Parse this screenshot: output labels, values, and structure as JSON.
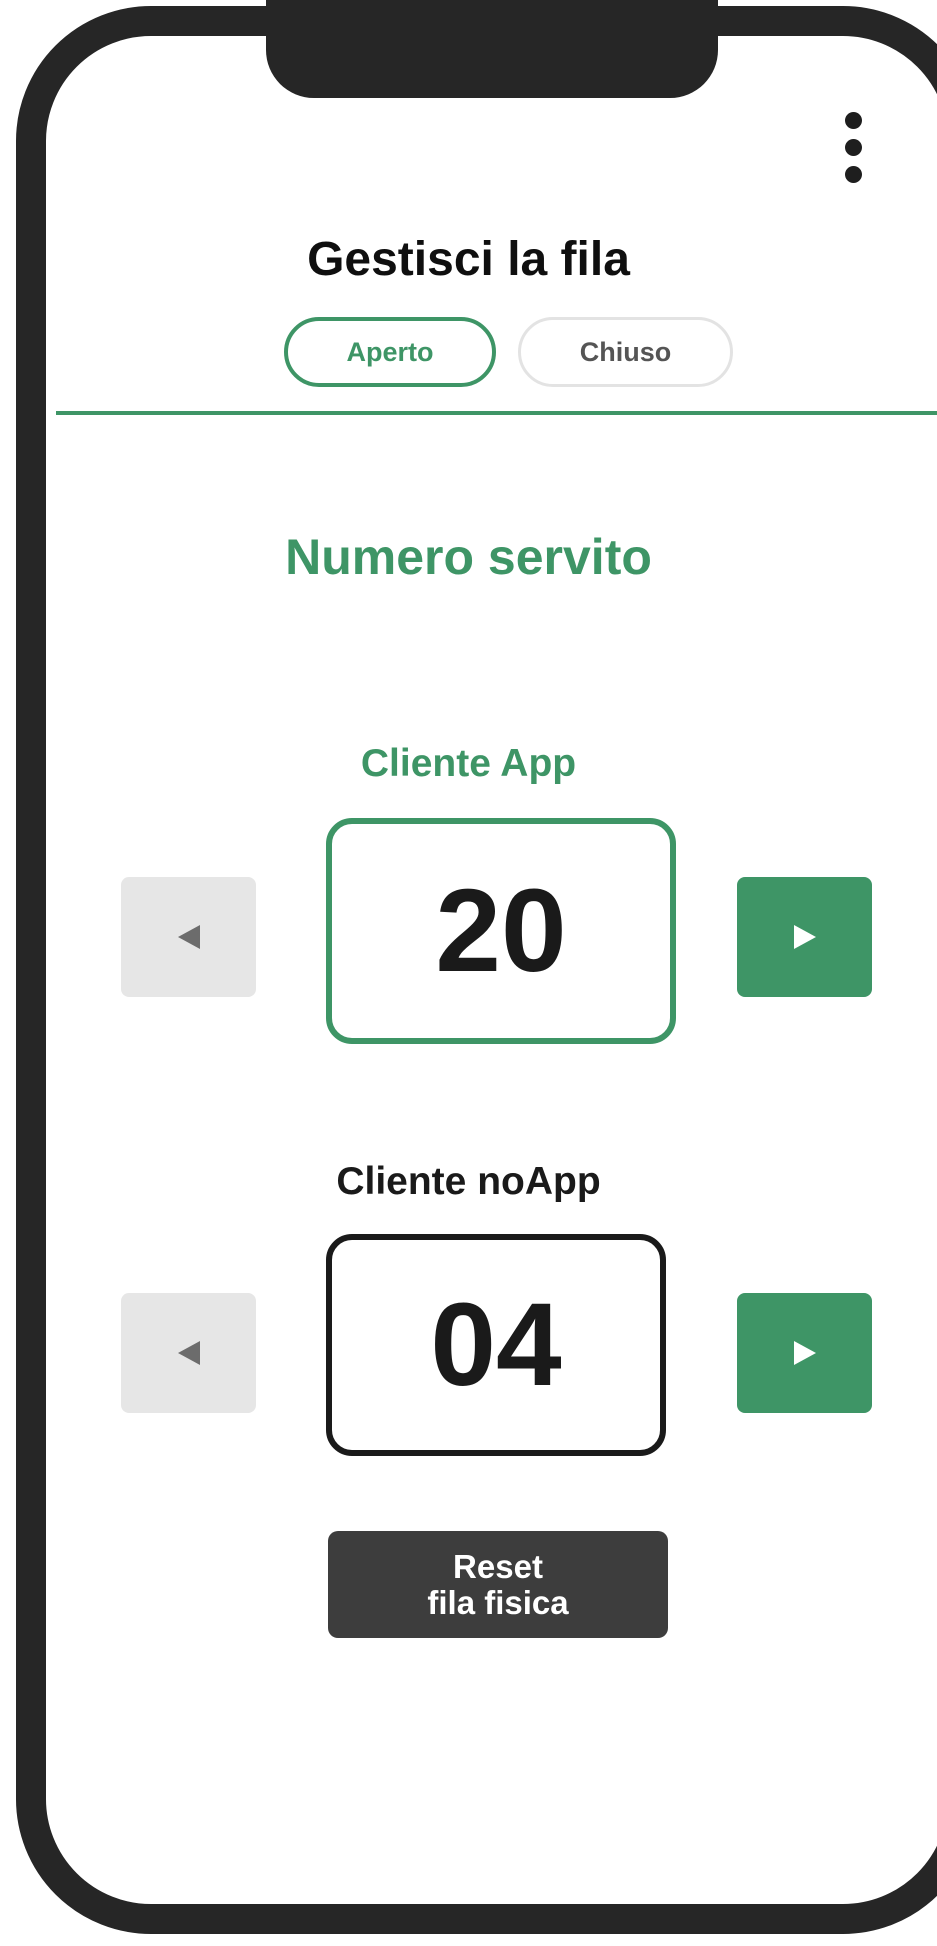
{
  "header": {
    "title": "Gestisci la fila",
    "menu_icon": "more-vertical-icon"
  },
  "status_toggle": {
    "open_label": "Aperto",
    "closed_label": "Chiuso",
    "selected": "Aperto"
  },
  "main": {
    "section_title": "Numero servito",
    "app_counter": {
      "label": "Cliente App",
      "value": "20"
    },
    "noapp_counter": {
      "label": "Cliente noApp",
      "value": "04"
    },
    "reset_button": {
      "line1": "Reset",
      "line2": "fila fisica"
    }
  },
  "colors": {
    "accent": "#3e9566",
    "frame": "#262626",
    "disabled": "#e6e6e6",
    "dark_button": "#3d3d3d"
  },
  "icons": {
    "prev": "triangle-left-icon",
    "next": "triangle-right-icon"
  }
}
